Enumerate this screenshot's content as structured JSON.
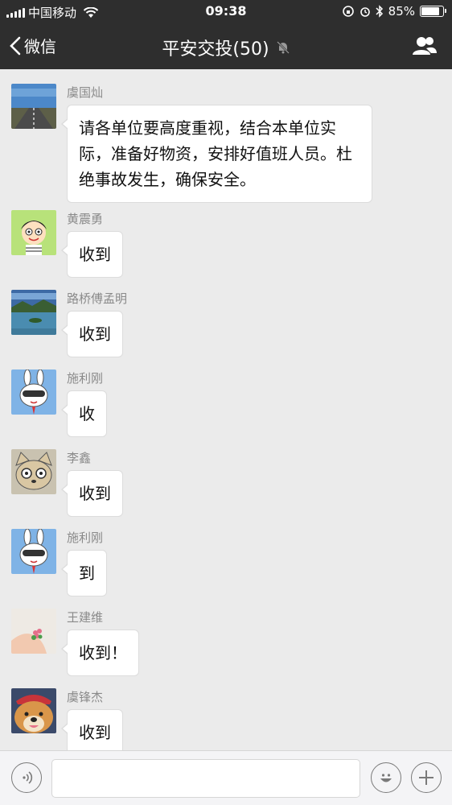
{
  "status_bar": {
    "carrier": "中国移动",
    "time": "09:38",
    "battery": "85%",
    "battery_level": 0.85
  },
  "nav": {
    "back_label": "微信",
    "title": "平安交投(50)"
  },
  "messages": [
    {
      "sender": "虞国灿",
      "text": "请各单位要高度重视，结合本单位实际，准备好物资，安排好值班人员。杜绝事故发生，确保安全。",
      "avatar": "road-landscape"
    },
    {
      "sender": "黄震勇",
      "text": "收到",
      "avatar": "cartoon-boy"
    },
    {
      "sender": "路桥傅孟明",
      "text": "收到",
      "avatar": "lake-landscape"
    },
    {
      "sender": "施利刚",
      "text": "收",
      "avatar": "cartoon-rabbit"
    },
    {
      "sender": "李鑫",
      "text": "收到",
      "avatar": "cartoon-cat"
    },
    {
      "sender": "施利刚",
      "text": "到",
      "avatar": "cartoon-rabbit"
    },
    {
      "sender": "王建维",
      "text": "收到！",
      "avatar": "hand-flower"
    },
    {
      "sender": "虞锋杰",
      "text": "收到",
      "avatar": "dog-photo"
    }
  ],
  "input": {
    "placeholder": ""
  },
  "icons": {
    "voice": "voice-icon",
    "emoji": "emoji-icon",
    "plus": "plus-icon",
    "group_info": "group-members-icon",
    "mute": "mute-bell-icon"
  }
}
